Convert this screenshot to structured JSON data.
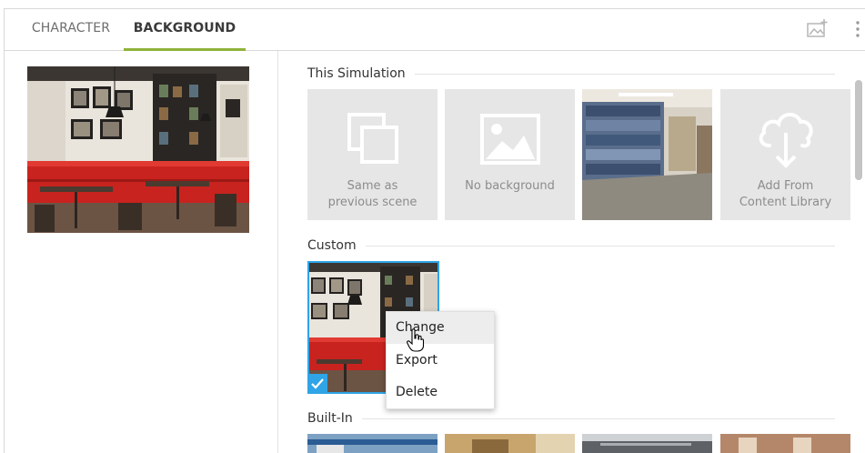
{
  "tabs": [
    {
      "label": "CHARACTER",
      "active": false
    },
    {
      "label": "BACKGROUND",
      "active": true
    }
  ],
  "toolbar": {
    "icons": [
      "add-image-icon",
      "more-vertical-icon"
    ]
  },
  "sections": {
    "this_simulation": {
      "title": "This Simulation",
      "tiles": [
        {
          "kind": "option",
          "icon": "copy-pages-icon",
          "label_line1": "Same as",
          "label_line2": "previous scene"
        },
        {
          "kind": "option",
          "icon": "image-placeholder-icon",
          "label_line1": "No background"
        },
        {
          "kind": "image",
          "description": "library-shelves-photo"
        },
        {
          "kind": "option",
          "icon": "cloud-download-icon",
          "label_line1": "Add From",
          "label_line2": "Content Library"
        }
      ]
    },
    "custom": {
      "title": "Custom",
      "selected": true
    },
    "built_in": {
      "title": "Built-In"
    }
  },
  "context_menu": {
    "items": [
      {
        "label": "Change",
        "hovered": true
      },
      {
        "label": "Export",
        "hovered": false
      },
      {
        "label": "Delete",
        "hovered": false
      }
    ]
  },
  "colors": {
    "accent_tab": "#8fb339",
    "selection_blue": "#2fa4e7",
    "sofa_red": "#c8231f",
    "tile_gray": "#e6e6e6"
  }
}
